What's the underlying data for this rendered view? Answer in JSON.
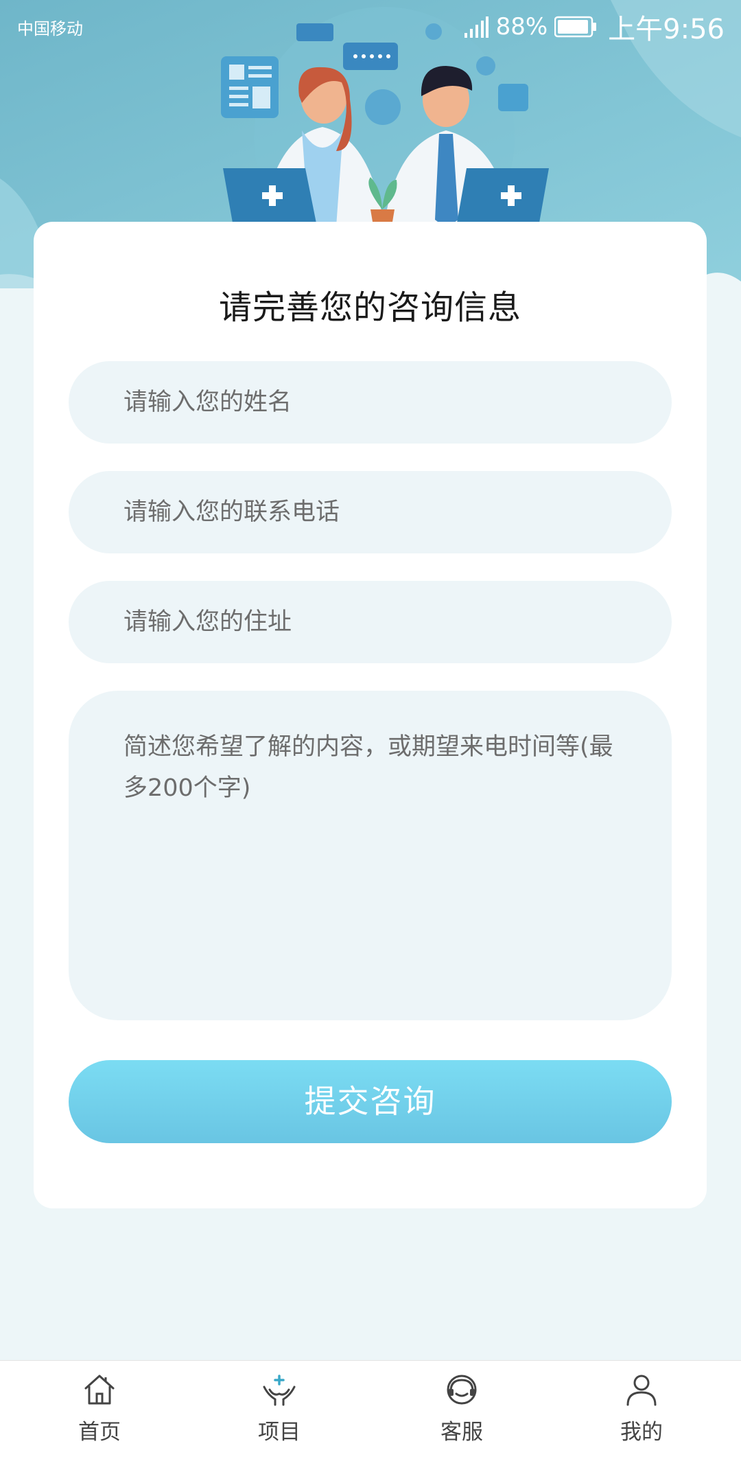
{
  "status_bar": {
    "carrier": "中国移动",
    "battery_percent": "88%",
    "time": "上午9:56"
  },
  "hero": {
    "illustration": "two-doctors-on-phone-illustration"
  },
  "form": {
    "title": "请完善您的咨询信息",
    "name_placeholder": "请输入您的姓名",
    "phone_placeholder": "请输入您的联系电话",
    "address_placeholder": "请输入您的住址",
    "content_placeholder": "简述您希望了解的内容，或期望来电时间等(最多200个字)",
    "submit_label": "提交咨询"
  },
  "tabbar": {
    "items": [
      {
        "label": "首页",
        "icon": "home-icon"
      },
      {
        "label": "项目",
        "icon": "hands-plus-icon"
      },
      {
        "label": "客服",
        "icon": "headset-icon"
      },
      {
        "label": "我的",
        "icon": "person-icon"
      }
    ]
  },
  "colors": {
    "hero_background": "#74bdd0",
    "button_gradient_top": "#7bdcf3",
    "button_gradient_bottom": "#69c5e3",
    "field_background": "#edf5f8",
    "page_background": "#edf6f8"
  }
}
